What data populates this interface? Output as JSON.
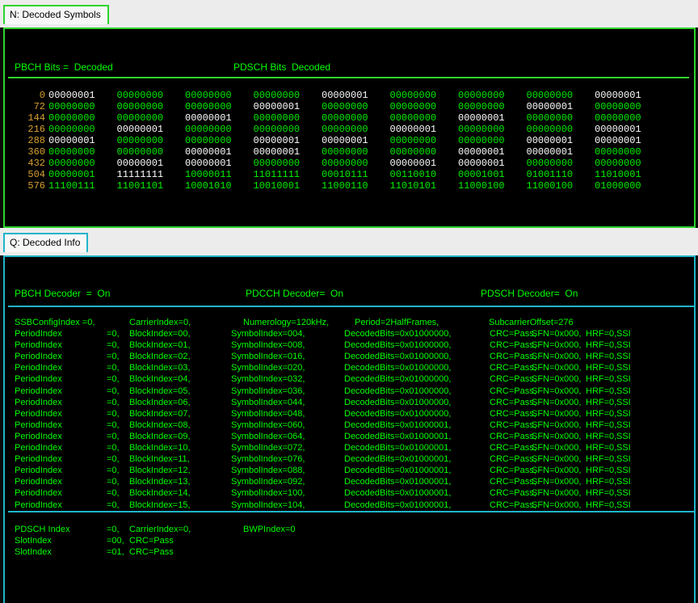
{
  "panel_n": {
    "tab_label": "N: Decoded Symbols",
    "pbch_bits_label": "PBCH Bits =  Decoded",
    "pdsch_bits_label": "PDSCH Bits  Decoded",
    "rows": [
      {
        "offset": "0",
        "words": [
          "00000001",
          "00000000",
          "00000000",
          "00000000",
          "00000001",
          "00000000",
          "00000000",
          "00000000",
          "00000001"
        ],
        "hi": [
          0,
          4,
          8
        ]
      },
      {
        "offset": "72",
        "words": [
          "00000000",
          "00000000",
          "00000000",
          "00000001",
          "00000000",
          "00000000",
          "00000000",
          "00000001",
          "00000000"
        ],
        "hi": [
          3,
          7
        ]
      },
      {
        "offset": "144",
        "words": [
          "00000000",
          "00000000",
          "00000001",
          "00000000",
          "00000000",
          "00000000",
          "00000001",
          "00000000",
          "00000000"
        ],
        "hi": [
          2,
          6
        ]
      },
      {
        "offset": "216",
        "words": [
          "00000000",
          "00000001",
          "00000000",
          "00000000",
          "00000000",
          "00000001",
          "00000000",
          "00000000",
          "00000001"
        ],
        "hi": [
          1,
          5,
          8
        ]
      },
      {
        "offset": "288",
        "words": [
          "00000001",
          "00000000",
          "00000000",
          "00000001",
          "00000001",
          "00000000",
          "00000000",
          "00000001",
          "00000001"
        ],
        "hi": [
          0,
          3,
          4,
          7,
          8
        ]
      },
      {
        "offset": "360",
        "words": [
          "00000000",
          "00000000",
          "00000001",
          "00000001",
          "00000000",
          "00000000",
          "00000001",
          "00000001",
          "00000000"
        ],
        "hi": [
          2,
          3,
          6,
          7
        ]
      },
      {
        "offset": "432",
        "words": [
          "00000000",
          "00000001",
          "00000001",
          "00000000",
          "00000000",
          "00000001",
          "00000001",
          "00000000",
          "00000000"
        ],
        "hi": [
          1,
          2,
          5,
          6
        ]
      },
      {
        "offset": "504",
        "words": [
          "00000001",
          "11111111",
          "10000011",
          "11011111",
          "00010111",
          "00110010",
          "00001001",
          "01001110",
          "11010001"
        ],
        "hi": [
          1
        ]
      },
      {
        "offset": "576",
        "words": [
          "11100111",
          "11001101",
          "10001010",
          "10010001",
          "11000110",
          "11010101",
          "11000100",
          "11000100",
          "01000000"
        ],
        "hi": []
      }
    ]
  },
  "panel_q": {
    "tab_label": "Q: Decoded Info",
    "pbch_decoder": "PBCH Decoder  =  On",
    "pdcch_decoder": "PDCCH Decoder=  On",
    "pdsch_decoder": "PDSCH Decoder=  On",
    "ssb_config": {
      "a": "SSBConfigIndex =0,",
      "b": "CarrierIndex=0,",
      "c": "Numerology=120kHz,",
      "d": "Period=2HalfFrames,",
      "e": "SubcarrierOffset=276"
    },
    "rows": [
      [
        "PeriodIndex",
        "=0,",
        "BlockIndex=00,",
        "SymbolIndex=004,",
        "DecodedBits=0x01000000,",
        "CRC=Pass,",
        "SFN=0x000,",
        "HRF=0,",
        "SSI"
      ],
      [
        "PeriodIndex",
        "=0,",
        "BlockIndex=01,",
        "SymbolIndex=008,",
        "DecodedBits=0x01000000,",
        "CRC=Pass,",
        "SFN=0x000,",
        "HRF=0,",
        "SSI"
      ],
      [
        "PeriodIndex",
        "=0,",
        "BlockIndex=02,",
        "SymbolIndex=016,",
        "DecodedBits=0x01000000,",
        "CRC=Pass,",
        "SFN=0x000,",
        "HRF=0,",
        "SSI"
      ],
      [
        "PeriodIndex",
        "=0,",
        "BlockIndex=03,",
        "SymbolIndex=020,",
        "DecodedBits=0x01000000,",
        "CRC=Pass,",
        "SFN=0x000,",
        "HRF=0,",
        "SSI"
      ],
      [
        "PeriodIndex",
        "=0,",
        "BlockIndex=04,",
        "SymbolIndex=032,",
        "DecodedBits=0x01000000,",
        "CRC=Pass,",
        "SFN=0x000,",
        "HRF=0,",
        "SSI"
      ],
      [
        "PeriodIndex",
        "=0,",
        "BlockIndex=05,",
        "SymbolIndex=036,",
        "DecodedBits=0x01000000,",
        "CRC=Pass,",
        "SFN=0x000,",
        "HRF=0,",
        "SSI"
      ],
      [
        "PeriodIndex",
        "=0,",
        "BlockIndex=06,",
        "SymbolIndex=044,",
        "DecodedBits=0x01000000,",
        "CRC=Pass,",
        "SFN=0x000,",
        "HRF=0,",
        "SSI"
      ],
      [
        "PeriodIndex",
        "=0,",
        "BlockIndex=07,",
        "SymbolIndex=048,",
        "DecodedBits=0x01000000,",
        "CRC=Pass,",
        "SFN=0x000,",
        "HRF=0,",
        "SSI"
      ],
      [
        "PeriodIndex",
        "=0,",
        "BlockIndex=08,",
        "SymbolIndex=060,",
        "DecodedBits=0x01000001,",
        "CRC=Pass,",
        "SFN=0x000,",
        "HRF=0,",
        "SSI"
      ],
      [
        "PeriodIndex",
        "=0,",
        "BlockIndex=09,",
        "SymbolIndex=064,",
        "DecodedBits=0x01000001,",
        "CRC=Pass,",
        "SFN=0x000,",
        "HRF=0,",
        "SSI"
      ],
      [
        "PeriodIndex",
        "=0,",
        "BlockIndex=10,",
        "SymbolIndex=072,",
        "DecodedBits=0x01000001,",
        "CRC=Pass,",
        "SFN=0x000,",
        "HRF=0,",
        "SSI"
      ],
      [
        "PeriodIndex",
        "=0,",
        "BlockIndex=11,",
        "SymbolIndex=076,",
        "DecodedBits=0x01000001,",
        "CRC=Pass,",
        "SFN=0x000,",
        "HRF=0,",
        "SSI"
      ],
      [
        "PeriodIndex",
        "=0,",
        "BlockIndex=12,",
        "SymbolIndex=088,",
        "DecodedBits=0x01000001,",
        "CRC=Pass,",
        "SFN=0x000,",
        "HRF=0,",
        "SSI"
      ],
      [
        "PeriodIndex",
        "=0,",
        "BlockIndex=13,",
        "SymbolIndex=092,",
        "DecodedBits=0x01000001,",
        "CRC=Pass,",
        "SFN=0x000,",
        "HRF=0,",
        "SSI"
      ],
      [
        "PeriodIndex",
        "=0,",
        "BlockIndex=14,",
        "SymbolIndex=100,",
        "DecodedBits=0x01000001,",
        "CRC=Pass,",
        "SFN=0x000,",
        "HRF=0,",
        "SSI"
      ],
      [
        "PeriodIndex",
        "=0,",
        "BlockIndex=15,",
        "SymbolIndex=104,",
        "DecodedBits=0x01000001,",
        "CRC=Pass,",
        "SFN=0x000,",
        "HRF=0,",
        "SSI"
      ]
    ],
    "pdsch": {
      "r1": [
        "PDSCH Index",
        "=0,",
        "CarrierIndex=0,",
        "BWPIndex=0"
      ],
      "r2": [
        "SlotIndex",
        "=00,",
        "CRC=Pass"
      ],
      "r3": [
        "SlotIndex",
        "=01,",
        "CRC=Pass"
      ]
    }
  },
  "colors": {
    "green_text": "#00ff00",
    "offset_text": "#d7a030",
    "panel_n_border": "#2ed52e",
    "panel_q_border": "#1fb5c9"
  }
}
